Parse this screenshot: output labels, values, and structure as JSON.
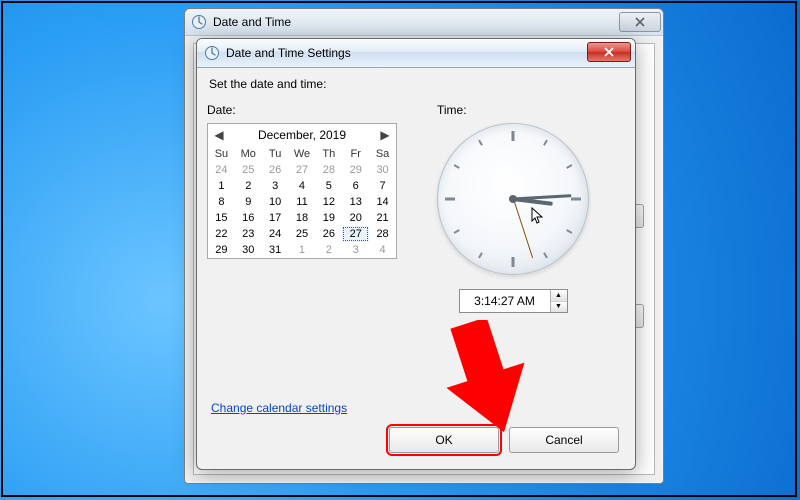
{
  "back_window": {
    "title": "Date and Time"
  },
  "dialog": {
    "title": "Date and Time Settings",
    "instruction": "Set the date and time:",
    "date_label": "Date:",
    "time_label": "Time:",
    "calendar": {
      "month_title": "December, 2019",
      "dows": [
        "Su",
        "Mo",
        "Tu",
        "We",
        "Th",
        "Fr",
        "Sa"
      ],
      "leading_muted": [
        24,
        25,
        26,
        27,
        28,
        29,
        30
      ],
      "month_days": [
        1,
        2,
        3,
        4,
        5,
        6,
        7,
        8,
        9,
        10,
        11,
        12,
        13,
        14,
        15,
        16,
        17,
        18,
        19,
        20,
        21,
        22,
        23,
        24,
        25,
        26,
        27,
        28,
        29,
        30,
        31
      ],
      "trailing_muted": [
        1,
        2,
        3,
        4
      ],
      "selected_day": 27
    },
    "time_value": "3:14:27 AM",
    "clock": {
      "hour": 3,
      "minute": 14,
      "second": 27
    },
    "link_label": "Change calendar settings",
    "ok_label": "OK",
    "cancel_label": "Cancel"
  }
}
